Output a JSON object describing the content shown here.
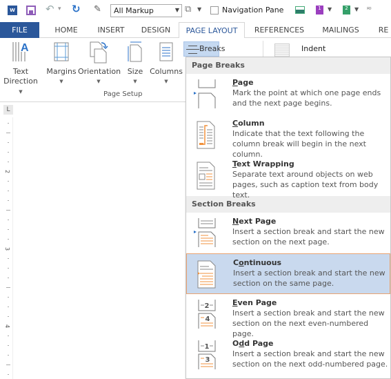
{
  "quick_access": {
    "app_logo": "W",
    "markup_select": "All Markup",
    "navigation_pane_label": "Navigation Pane",
    "page1_badge": "1",
    "page2_badge": "2"
  },
  "tabs": [
    {
      "label": "FILE"
    },
    {
      "label": "HOME"
    },
    {
      "label": "INSERT"
    },
    {
      "label": "DESIGN"
    },
    {
      "label": "PAGE LAYOUT",
      "active": true
    },
    {
      "label": "REFERENCES"
    },
    {
      "label": "MAILINGS"
    },
    {
      "label": "RE"
    }
  ],
  "ribbon": {
    "buttons": [
      {
        "line1": "Text",
        "line2": "Direction"
      },
      {
        "line1": "Margins"
      },
      {
        "line1": "Orientation"
      },
      {
        "line1": "Size"
      },
      {
        "line1": "Columns"
      }
    ],
    "group_label": "Page Setup",
    "breaks_label": "Breaks",
    "indent_label": "Indent"
  },
  "ruler": {
    "corner": "L",
    "numbers": [
      "2",
      "3",
      "4"
    ]
  },
  "breaks_menu": {
    "sections": [
      {
        "header": "Page Breaks",
        "items": [
          {
            "title_pre": "",
            "title_u": "P",
            "title_post": "age",
            "desc": "Mark the point at which one page ends and the next page begins."
          },
          {
            "title_pre": "",
            "title_u": "C",
            "title_post": "olumn",
            "desc": "Indicate that the text following the column break will begin in the next column."
          },
          {
            "title_pre": "",
            "title_u": "T",
            "title_post": "ext Wrapping",
            "desc": "Separate text around objects on web pages, such as caption text from body text."
          }
        ]
      },
      {
        "header": "Section Breaks",
        "items": [
          {
            "title_pre": "",
            "title_u": "N",
            "title_post": "ext Page",
            "desc": "Insert a section break and start the new section on the next page."
          },
          {
            "title_pre": "C",
            "title_u": "o",
            "title_post": "ntinuous",
            "desc": "Insert a section break and start the new section on the same page.",
            "highlighted": true
          },
          {
            "title_pre": "",
            "title_u": "E",
            "title_post": "ven Page",
            "desc": "Insert a section break and start the new section on the next even-numbered page.",
            "badge_top": "2",
            "badge_bottom": "4"
          },
          {
            "title_pre": "O",
            "title_u": "d",
            "title_post": "d Page",
            "desc": "Insert a section break and start the new section on the next odd-numbered page.",
            "badge_top": "1",
            "badge_bottom": "3"
          }
        ]
      }
    ]
  },
  "colors": {
    "file_tab": "#2b579a",
    "highlight_bg": "#c9d9ee",
    "highlight_border": "#e8a271",
    "accent_orange": "#f0913c"
  }
}
